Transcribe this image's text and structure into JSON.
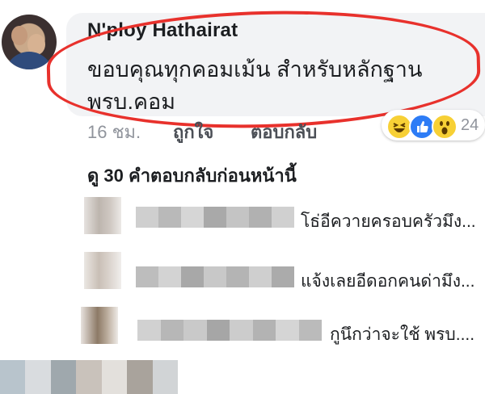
{
  "comment": {
    "author": "N'ploy Hathairat",
    "text_line1": "ขอบคุณทุกคอมเม้น สำหรับหลักฐาน",
    "text_line2": "พรบ.คอม"
  },
  "meta": {
    "time": "16 ชม.",
    "like": "ถูกใจ",
    "reply": "ตอบกลับ",
    "reaction_count": "24",
    "reaction_icons": [
      "haha-icon",
      "like-icon",
      "wow-icon"
    ]
  },
  "previous_replies_label": "ดู 30 คำตอบกลับก่อนหน้านี้",
  "replies": [
    {
      "text": "โธ่อีควายครอบครัวมึง..."
    },
    {
      "text": "แจ้งเลยอีดอกคนด่ามึง..."
    },
    {
      "text": "กูนึกว่าจะใช้ พรบ...."
    }
  ],
  "colors": {
    "highlight_ring": "#e8312c",
    "bubble": "#f2f3f5",
    "meta_gray": "#90949c",
    "like_blue": "#2d7cf6"
  }
}
